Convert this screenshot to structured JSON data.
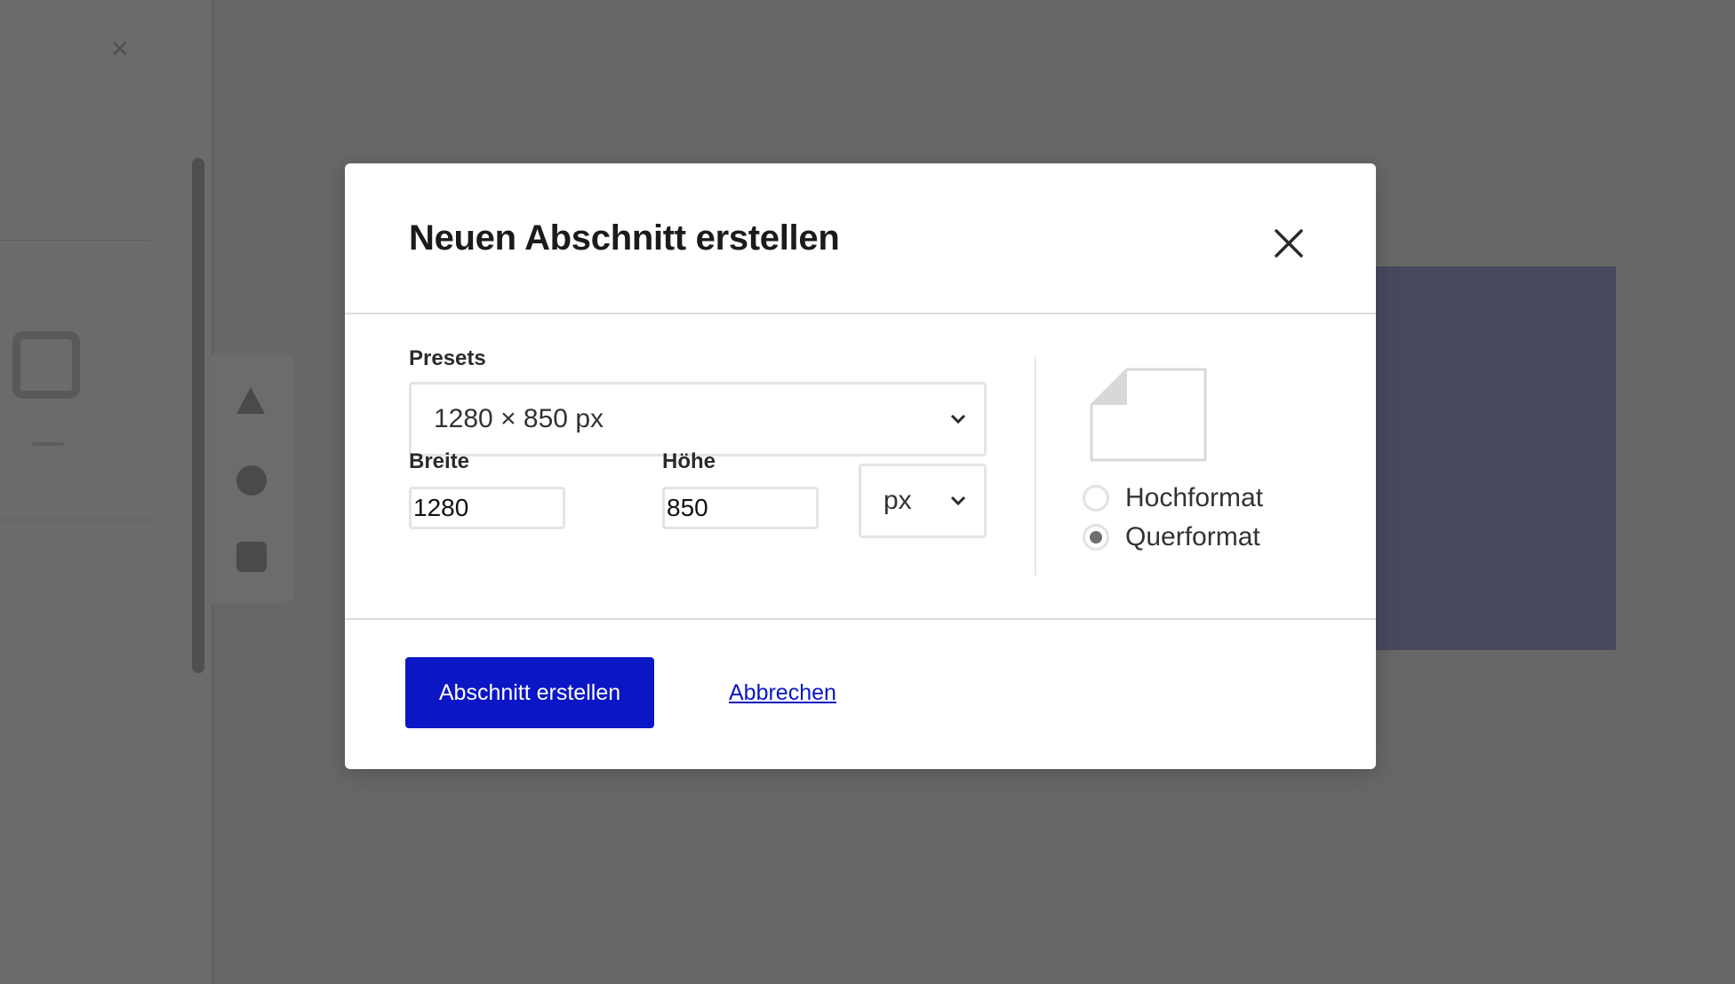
{
  "dialog": {
    "title": "Neuen Abschnitt erstellen",
    "presets_label": "Presets",
    "presets_value": "1280 × 850 px",
    "width_label": "Breite",
    "width_value": "1280",
    "height_label": "Höhe",
    "height_value": "850",
    "unit_value": "px",
    "orientation": {
      "options": [
        "Hochformat",
        "Querformat"
      ],
      "selected": "Querformat"
    },
    "create_button_label": "Abschnitt erstellen",
    "cancel_label": "Abbrechen"
  },
  "icons": {
    "close": "close-icon",
    "chevron": "chevron-down-icon",
    "times": "times-icon",
    "orientation_preview": "page-landscape-icon"
  },
  "colors": {
    "primary": "#0b17c5",
    "overlay": "#676767",
    "canvas_background": "#47485e"
  }
}
